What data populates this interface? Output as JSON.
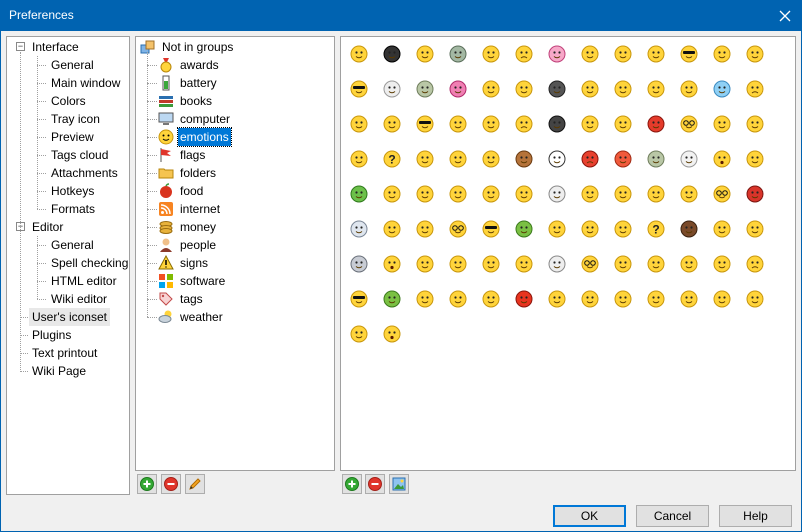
{
  "window": {
    "title": "Preferences"
  },
  "left_tree": {
    "items": [
      {
        "label": "Interface",
        "level": 0,
        "expander": "minus"
      },
      {
        "label": "General",
        "level": 1
      },
      {
        "label": "Main window",
        "level": 1
      },
      {
        "label": "Colors",
        "level": 1
      },
      {
        "label": "Tray icon",
        "level": 1
      },
      {
        "label": "Preview",
        "level": 1
      },
      {
        "label": "Tags cloud",
        "level": 1
      },
      {
        "label": "Attachments",
        "level": 1
      },
      {
        "label": "Hotkeys",
        "level": 1
      },
      {
        "label": "Formats",
        "level": 1
      },
      {
        "label": "Editor",
        "level": 0,
        "expander": "minus"
      },
      {
        "label": "General",
        "level": 1
      },
      {
        "label": "Spell checking",
        "level": 1
      },
      {
        "label": "HTML editor",
        "level": 1
      },
      {
        "label": "Wiki editor",
        "level": 1
      },
      {
        "label": "User's iconset",
        "level": 0,
        "selected": true
      },
      {
        "label": "Plugins",
        "level": 0
      },
      {
        "label": "Text printout",
        "level": 0
      },
      {
        "label": "Wiki Page",
        "level": 0
      }
    ]
  },
  "group_tree": {
    "root": {
      "label": "Not in groups",
      "icon": "boxes-icon"
    },
    "items": [
      {
        "label": "awards",
        "icon": "award-icon"
      },
      {
        "label": "battery",
        "icon": "battery-icon"
      },
      {
        "label": "books",
        "icon": "books-icon"
      },
      {
        "label": "computer",
        "icon": "computer-icon"
      },
      {
        "label": "emotions",
        "icon": "smiley-icon",
        "selected": true
      },
      {
        "label": "flags",
        "icon": "flag-icon"
      },
      {
        "label": "folders",
        "icon": "folder-icon"
      },
      {
        "label": "food",
        "icon": "apple-icon"
      },
      {
        "label": "internet",
        "icon": "rss-icon"
      },
      {
        "label": "money",
        "icon": "coins-icon"
      },
      {
        "label": "people",
        "icon": "person-icon"
      },
      {
        "label": "signs",
        "icon": "warning-sign-icon"
      },
      {
        "label": "software",
        "icon": "windows-logo-icon"
      },
      {
        "label": "tags",
        "icon": "tag-icon"
      },
      {
        "label": "weather",
        "icon": "weather-icon"
      }
    ]
  },
  "group_toolbar": [
    "add-icon",
    "remove-icon",
    "edit-pencil-icon"
  ],
  "icon_toolbar": [
    "add-icon",
    "remove-icon",
    "image-icon"
  ],
  "icon_grid": {
    "columns": 13,
    "icons": [
      "blush",
      "black-mask",
      "grin",
      "alien",
      "happy",
      "sad",
      "pink-face",
      "laugh",
      "notes",
      "smile",
      "ninja",
      "purple-eye",
      "smile",
      "sunglasses",
      "ghost-white",
      "zombie",
      "pink-blob",
      "kiss",
      "pray",
      "hat",
      "wink-mark",
      "smile",
      "kiss-heart",
      "clown",
      "cold",
      "angry",
      "confused",
      "cage",
      "sunglasses",
      "grin",
      "wink",
      "cry",
      "hacker",
      "dizzy",
      "magnifier",
      "devil",
      "glasses",
      "smile",
      "waving",
      "thinking",
      "question",
      "grin",
      "laugh",
      "blush",
      "monkey",
      "panda",
      "rage",
      "redface",
      "zombie",
      "ghost",
      "surprised",
      "reading",
      "green-alien",
      "grin",
      "laugh",
      "salute",
      "smile",
      "smile",
      "skull",
      "cap",
      "smile",
      "grandpa",
      "nurse",
      "glasses",
      "mario",
      "astronaut",
      "laugh",
      "mummy",
      "glasses",
      "ninja",
      "green",
      "pirate",
      "smile",
      "police",
      "question",
      "dark",
      "smile",
      "smile",
      "robot",
      "surprised",
      "tongue",
      "magnifier",
      "smile",
      "sick",
      "skull",
      "glasses",
      "sleep",
      "egypt",
      "smile",
      "teacher",
      "angry",
      "bandit",
      "green",
      "smile",
      "smile",
      "eyepatch",
      "tomato",
      "smile",
      "smile",
      "blush",
      "viking",
      "smile",
      "kiss",
      "smile",
      "wink",
      "shocked"
    ]
  },
  "buttons": {
    "ok": "OK",
    "cancel": "Cancel",
    "help": "Help"
  },
  "colors": {
    "selection": "#0078d7",
    "titlebar": "#0063b1",
    "emoji_yellow": "#ffd43b"
  }
}
